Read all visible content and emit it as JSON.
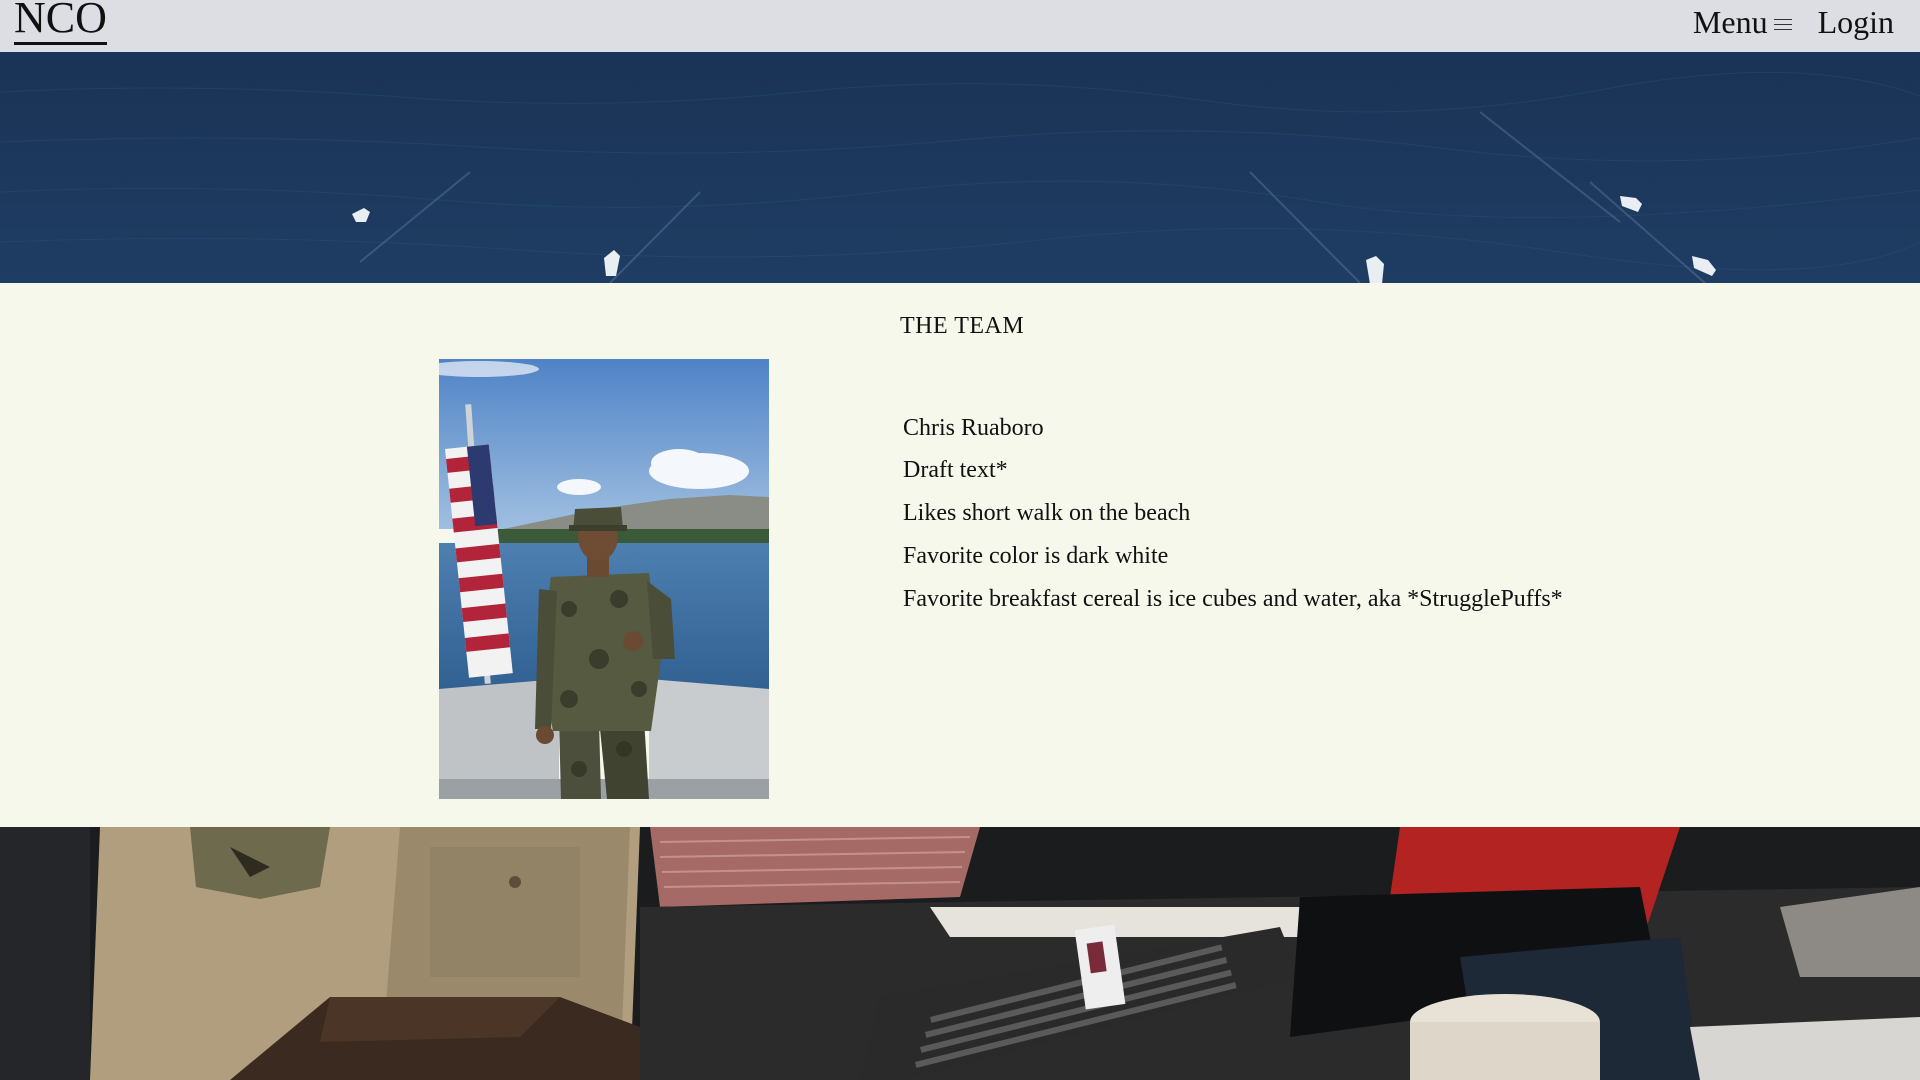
{
  "header": {
    "logo": "NCO",
    "menu_label": "Menu",
    "menu_icon": "hamburger-icon",
    "login_label": "Login"
  },
  "hero": {
    "image": "ocean-boats-aerial"
  },
  "team": {
    "title": "THE TEAM",
    "members": [
      {
        "name": "Chris Ruaboro",
        "photo": "marine-on-ship-with-flag",
        "lines": [
          "Draft text*",
          "Likes short walk on the beach",
          "Favorite color is dark white",
          "Favorite breakfast cereal is ice cubes and water, aka *StrugglePuffs*"
        ]
      }
    ]
  },
  "footer_image": {
    "image": "marine-at-desk-keyboard"
  },
  "colors": {
    "header_bg": "#dcdee3",
    "section_bg": "#f5f8ea",
    "ocean": "#1c3658",
    "text": "#111111"
  }
}
